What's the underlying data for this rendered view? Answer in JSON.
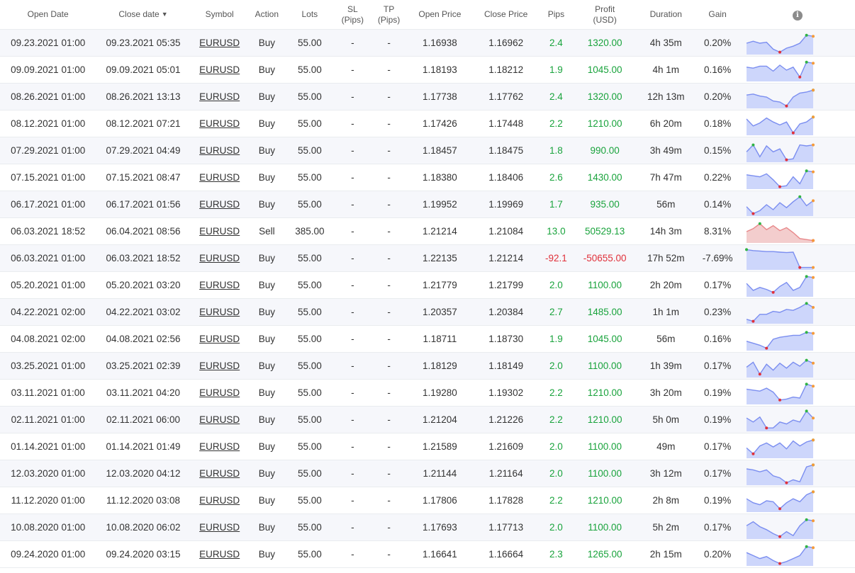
{
  "headers": {
    "open_date": "Open Date",
    "close_date": "Close date",
    "close_date_sort": "▼",
    "symbol": "Symbol",
    "action": "Action",
    "lots": "Lots",
    "sl_1": "SL",
    "sl_2": "(Pips)",
    "tp_1": "TP",
    "tp_2": "(Pips)",
    "open_price": "Open Price",
    "close_price": "Close Price",
    "pips": "Pips",
    "profit_1": "Profit",
    "profit_2": "(USD)",
    "duration": "Duration",
    "gain": "Gain",
    "info_icon": "info-icon"
  },
  "colors": {
    "positive": "#19a33c",
    "negative": "#e0303a",
    "spark_blue_line": "#7b8ef0",
    "spark_blue_fill": "#cdd6fb",
    "spark_red_line": "#e8888a",
    "spark_red_fill": "#f3cdcd",
    "marker_high": "#2fb344",
    "marker_low": "#e0303a",
    "marker_last": "#f59a3a"
  },
  "rows": [
    {
      "open": "09.23.2021 01:00",
      "close": "09.23.2021 05:35",
      "symbol": "EURUSD",
      "action": "Buy",
      "lots": "55.00",
      "sl": "-",
      "tp": "-",
      "open_price": "1.16938",
      "close_price": "1.16962",
      "pips": "2.4",
      "profit": "1320.00",
      "duration": "4h 35m",
      "gain": "0.20%",
      "sign": "pos",
      "spark": "blue",
      "trend": [
        0.5,
        0.4,
        0.5,
        0.45,
        0.8,
        0.95,
        0.75,
        0.65,
        0.5,
        0.1,
        0.15
      ]
    },
    {
      "open": "09.09.2021 01:00",
      "close": "09.09.2021 05:01",
      "symbol": "EURUSD",
      "action": "Buy",
      "lots": "55.00",
      "sl": "-",
      "tp": "-",
      "open_price": "1.18193",
      "close_price": "1.18212",
      "pips": "1.9",
      "profit": "1045.00",
      "duration": "4h 1m",
      "gain": "0.16%",
      "sign": "pos",
      "spark": "blue",
      "trend": [
        0.35,
        0.4,
        0.3,
        0.3,
        0.55,
        0.25,
        0.5,
        0.35,
        0.85,
        0.1,
        0.15
      ]
    },
    {
      "open": "08.26.2021 01:00",
      "close": "08.26.2021 13:13",
      "symbol": "EURUSD",
      "action": "Buy",
      "lots": "55.00",
      "sl": "-",
      "tp": "-",
      "open_price": "1.17738",
      "close_price": "1.17762",
      "pips": "2.4",
      "profit": "1320.00",
      "duration": "12h 13m",
      "gain": "0.20%",
      "sign": "pos",
      "spark": "blue",
      "trend": [
        0.4,
        0.35,
        0.45,
        0.5,
        0.7,
        0.75,
        0.95,
        0.5,
        0.3,
        0.25,
        0.15
      ]
    },
    {
      "open": "08.12.2021 01:00",
      "close": "08.12.2021 07:21",
      "symbol": "EURUSD",
      "action": "Buy",
      "lots": "55.00",
      "sl": "-",
      "tp": "-",
      "open_price": "1.17426",
      "close_price": "1.17448",
      "pips": "2.2",
      "profit": "1210.00",
      "duration": "6h 20m",
      "gain": "0.18%",
      "sign": "pos",
      "spark": "blue",
      "trend": [
        0.25,
        0.6,
        0.45,
        0.2,
        0.4,
        0.55,
        0.4,
        0.95,
        0.5,
        0.4,
        0.15
      ]
    },
    {
      "open": "07.29.2021 01:00",
      "close": "07.29.2021 04:49",
      "symbol": "EURUSD",
      "action": "Buy",
      "lots": "55.00",
      "sl": "-",
      "tp": "-",
      "open_price": "1.18457",
      "close_price": "1.18475",
      "pips": "1.8",
      "profit": "990.00",
      "duration": "3h 49m",
      "gain": "0.15%",
      "sign": "pos",
      "spark": "blue",
      "trend": [
        0.55,
        0.2,
        0.8,
        0.25,
        0.55,
        0.4,
        0.95,
        0.9,
        0.2,
        0.25,
        0.2
      ]
    },
    {
      "open": "07.15.2021 01:00",
      "close": "07.15.2021 08:47",
      "symbol": "EURUSD",
      "action": "Buy",
      "lots": "55.00",
      "sl": "-",
      "tp": "-",
      "open_price": "1.18380",
      "close_price": "1.18406",
      "pips": "2.6",
      "profit": "1430.00",
      "duration": "7h 47m",
      "gain": "0.22%",
      "sign": "pos",
      "spark": "blue",
      "trend": [
        0.35,
        0.4,
        0.45,
        0.3,
        0.6,
        0.95,
        0.9,
        0.45,
        0.8,
        0.15,
        0.2
      ]
    },
    {
      "open": "06.17.2021 01:00",
      "close": "06.17.2021 01:56",
      "symbol": "EURUSD",
      "action": "Buy",
      "lots": "55.00",
      "sl": "-",
      "tp": "-",
      "open_price": "1.19952",
      "close_price": "1.19969",
      "pips": "1.7",
      "profit": "935.00",
      "duration": "56m",
      "gain": "0.14%",
      "sign": "pos",
      "spark": "blue",
      "trend": [
        0.6,
        0.95,
        0.8,
        0.5,
        0.75,
        0.4,
        0.65,
        0.35,
        0.1,
        0.55,
        0.3
      ]
    },
    {
      "open": "06.03.2021 18:52",
      "close": "06.04.2021 08:56",
      "symbol": "EURUSD",
      "action": "Sell",
      "lots": "385.00",
      "sl": "-",
      "tp": "-",
      "open_price": "1.21214",
      "close_price": "1.21084",
      "pips": "13.0",
      "profit": "50529.13",
      "duration": "14h 3m",
      "gain": "8.31%",
      "sign": "pos",
      "spark": "red",
      "trend": [
        0.5,
        0.35,
        0.1,
        0.4,
        0.2,
        0.45,
        0.3,
        0.55,
        0.85,
        0.9,
        0.95
      ]
    },
    {
      "open": "06.03.2021 01:00",
      "close": "06.03.2021 18:52",
      "symbol": "EURUSD",
      "action": "Buy",
      "lots": "55.00",
      "sl": "-",
      "tp": "-",
      "open_price": "1.22135",
      "close_price": "1.21214",
      "pips": "-92.1",
      "profit": "-50655.00",
      "duration": "17h 52m",
      "gain": "-7.69%",
      "sign": "neg",
      "spark": "blue",
      "trend": [
        0.05,
        0.1,
        0.12,
        0.15,
        0.15,
        0.18,
        0.2,
        0.18,
        0.95,
        0.95,
        0.95
      ]
    },
    {
      "open": "05.20.2021 01:00",
      "close": "05.20.2021 03:20",
      "symbol": "EURUSD",
      "action": "Buy",
      "lots": "55.00",
      "sl": "-",
      "tp": "-",
      "open_price": "1.21779",
      "close_price": "1.21799",
      "pips": "2.0",
      "profit": "1100.00",
      "duration": "2h 20m",
      "gain": "0.17%",
      "sign": "pos",
      "spark": "blue",
      "trend": [
        0.4,
        0.75,
        0.6,
        0.7,
        0.85,
        0.55,
        0.35,
        0.75,
        0.6,
        0.05,
        0.1
      ]
    },
    {
      "open": "04.22.2021 02:00",
      "close": "04.22.2021 03:02",
      "symbol": "EURUSD",
      "action": "Buy",
      "lots": "55.00",
      "sl": "-",
      "tp": "-",
      "open_price": "1.20357",
      "close_price": "1.20384",
      "pips": "2.7",
      "profit": "1485.00",
      "duration": "1h 1m",
      "gain": "0.23%",
      "sign": "pos",
      "spark": "blue",
      "trend": [
        0.85,
        0.95,
        0.6,
        0.6,
        0.45,
        0.5,
        0.35,
        0.4,
        0.25,
        0.05,
        0.25
      ]
    },
    {
      "open": "04.08.2021 02:00",
      "close": "04.08.2021 02:56",
      "symbol": "EURUSD",
      "action": "Buy",
      "lots": "55.00",
      "sl": "-",
      "tp": "-",
      "open_price": "1.18711",
      "close_price": "1.18730",
      "pips": "1.9",
      "profit": "1045.00",
      "duration": "56m",
      "gain": "0.16%",
      "sign": "pos",
      "spark": "blue",
      "trend": [
        0.6,
        0.7,
        0.8,
        0.95,
        0.5,
        0.4,
        0.35,
        0.3,
        0.3,
        0.15,
        0.2
      ]
    },
    {
      "open": "03.25.2021 01:00",
      "close": "03.25.2021 02:39",
      "symbol": "EURUSD",
      "action": "Buy",
      "lots": "55.00",
      "sl": "-",
      "tp": "-",
      "open_price": "1.18129",
      "close_price": "1.18149",
      "pips": "2.0",
      "profit": "1100.00",
      "duration": "1h 39m",
      "gain": "0.17%",
      "sign": "pos",
      "spark": "blue",
      "trend": [
        0.55,
        0.3,
        0.9,
        0.4,
        0.7,
        0.35,
        0.6,
        0.3,
        0.5,
        0.2,
        0.35
      ]
    },
    {
      "open": "03.11.2021 01:00",
      "close": "03.11.2021 04:20",
      "symbol": "EURUSD",
      "action": "Buy",
      "lots": "55.00",
      "sl": "-",
      "tp": "-",
      "open_price": "1.19280",
      "close_price": "1.19302",
      "pips": "2.2",
      "profit": "1210.00",
      "duration": "3h 20m",
      "gain": "0.19%",
      "sign": "pos",
      "spark": "blue",
      "trend": [
        0.3,
        0.35,
        0.4,
        0.25,
        0.45,
        0.85,
        0.8,
        0.7,
        0.75,
        0.05,
        0.15
      ]
    },
    {
      "open": "02.11.2021 01:00",
      "close": "02.11.2021 06:00",
      "symbol": "EURUSD",
      "action": "Buy",
      "lots": "55.00",
      "sl": "-",
      "tp": "-",
      "open_price": "1.21204",
      "close_price": "1.21226",
      "pips": "2.2",
      "profit": "1210.00",
      "duration": "5h 0m",
      "gain": "0.19%",
      "sign": "pos",
      "spark": "blue",
      "trend": [
        0.4,
        0.6,
        0.35,
        0.9,
        0.9,
        0.6,
        0.7,
        0.5,
        0.6,
        0.05,
        0.4
      ]
    },
    {
      "open": "01.14.2021 01:00",
      "close": "01.14.2021 01:49",
      "symbol": "EURUSD",
      "action": "Buy",
      "lots": "55.00",
      "sl": "-",
      "tp": "-",
      "open_price": "1.21589",
      "close_price": "1.21609",
      "pips": "2.0",
      "profit": "1100.00",
      "duration": "49m",
      "gain": "0.17%",
      "sign": "pos",
      "spark": "blue",
      "trend": [
        0.55,
        0.85,
        0.45,
        0.3,
        0.5,
        0.3,
        0.6,
        0.2,
        0.45,
        0.25,
        0.15
      ]
    },
    {
      "open": "12.03.2020 01:00",
      "close": "12.03.2020 04:12",
      "symbol": "EURUSD",
      "action": "Buy",
      "lots": "55.00",
      "sl": "-",
      "tp": "-",
      "open_price": "1.21144",
      "close_price": "1.21164",
      "pips": "2.0",
      "profit": "1100.00",
      "duration": "3h 12m",
      "gain": "0.17%",
      "sign": "pos",
      "spark": "blue",
      "trend": [
        0.25,
        0.3,
        0.4,
        0.3,
        0.6,
        0.7,
        0.95,
        0.8,
        0.9,
        0.15,
        0.05
      ]
    },
    {
      "open": "11.12.2020 01:00",
      "close": "11.12.2020 03:08",
      "symbol": "EURUSD",
      "action": "Buy",
      "lots": "55.00",
      "sl": "-",
      "tp": "-",
      "open_price": "1.17806",
      "close_price": "1.17828",
      "pips": "2.2",
      "profit": "1210.00",
      "duration": "2h 8m",
      "gain": "0.19%",
      "sign": "pos",
      "spark": "blue",
      "trend": [
        0.4,
        0.6,
        0.7,
        0.5,
        0.55,
        0.9,
        0.6,
        0.4,
        0.55,
        0.2,
        0.05
      ]
    },
    {
      "open": "10.08.2020 01:00",
      "close": "10.08.2020 06:02",
      "symbol": "EURUSD",
      "action": "Buy",
      "lots": "55.00",
      "sl": "-",
      "tp": "-",
      "open_price": "1.17693",
      "close_price": "1.17713",
      "pips": "2.0",
      "profit": "1100.00",
      "duration": "5h 2m",
      "gain": "0.17%",
      "sign": "pos",
      "spark": "blue",
      "trend": [
        0.4,
        0.2,
        0.45,
        0.6,
        0.8,
        0.95,
        0.7,
        0.9,
        0.4,
        0.1,
        0.15
      ]
    },
    {
      "open": "09.24.2020 01:00",
      "close": "09.24.2020 03:15",
      "symbol": "EURUSD",
      "action": "Buy",
      "lots": "55.00",
      "sl": "-",
      "tp": "-",
      "open_price": "1.16641",
      "close_price": "1.16664",
      "pips": "2.3",
      "profit": "1265.00",
      "duration": "2h 15m",
      "gain": "0.20%",
      "sign": "pos",
      "spark": "blue",
      "trend": [
        0.4,
        0.55,
        0.7,
        0.6,
        0.8,
        0.95,
        0.85,
        0.7,
        0.55,
        0.1,
        0.15
      ]
    }
  ]
}
